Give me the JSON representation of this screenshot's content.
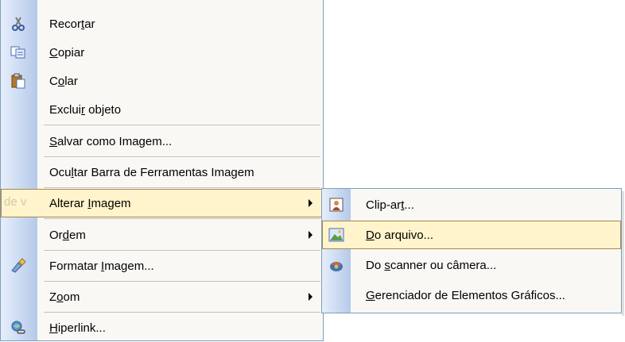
{
  "main_menu": {
    "items": [
      {
        "pre": "Recor",
        "ul": "t",
        "post": "ar",
        "icon": "scissors-icon"
      },
      {
        "pre": "",
        "ul": "C",
        "post": "opiar",
        "icon": "copy-icon"
      },
      {
        "pre": "C",
        "ul": "o",
        "post": "lar",
        "icon": "paste-icon"
      },
      {
        "pre": "Exclui",
        "ul": "r",
        "post": " objeto",
        "icon": ""
      },
      {
        "pre": "",
        "ul": "S",
        "post": "alvar como Imagem...",
        "icon": ""
      },
      {
        "pre": "Ocu",
        "ul": "l",
        "post": "tar Barra de Ferramentas Imagem",
        "icon": ""
      },
      {
        "pre": "Alterar ",
        "ul": "I",
        "post": "magem",
        "icon": "",
        "ghost": "de v"
      },
      {
        "pre": "Or",
        "ul": "d",
        "post": "em",
        "icon": ""
      },
      {
        "pre": "Formatar ",
        "ul": "I",
        "post": "magem...",
        "icon": "format-picture-icon"
      },
      {
        "pre": "Z",
        "ul": "o",
        "post": "om",
        "icon": ""
      },
      {
        "pre": "",
        "ul": "H",
        "post": "iperlink...",
        "icon": "hyperlink-icon"
      }
    ]
  },
  "sub_menu": {
    "items": [
      {
        "pre": "Clip-ar",
        "ul": "t",
        "post": "...",
        "icon": "clipart-icon"
      },
      {
        "pre": "",
        "ul": "D",
        "post": "o arquivo...",
        "icon": "picture-file-icon"
      },
      {
        "pre": "Do ",
        "ul": "s",
        "post": "canner ou câmera...",
        "icon": "scanner-camera-icon"
      },
      {
        "pre": "",
        "ul": "G",
        "post": "erenciador de Elementos Gráficos...",
        "icon": ""
      }
    ]
  },
  "colors": {
    "highlight_bg": "#fff4cc",
    "highlight_border": "#a8884a",
    "menu_bg": "#f9f8f4",
    "gutter": "#c9d8f1",
    "border": "#7f9db9"
  }
}
